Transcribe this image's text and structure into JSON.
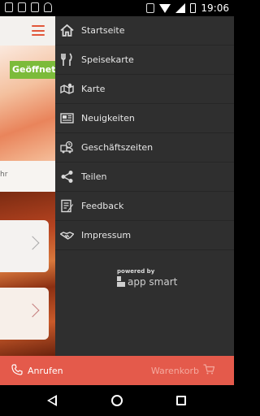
{
  "status_bar": {
    "time": "19:06"
  },
  "app": {
    "open_badge": "Geöffnet",
    "hours_fragment": "hr"
  },
  "drawer": {
    "items": [
      {
        "label": "Startseite",
        "icon": "home-icon"
      },
      {
        "label": "Speisekarte",
        "icon": "cutlery-icon"
      },
      {
        "label": "Karte",
        "icon": "map-icon"
      },
      {
        "label": "Neuigkeiten",
        "icon": "newspaper-icon"
      },
      {
        "label": "Geschäftszeiten",
        "icon": "clock-truck-icon"
      },
      {
        "label": "Teilen",
        "icon": "share-icon"
      },
      {
        "label": "Feedback",
        "icon": "feedback-icon"
      },
      {
        "label": "Impressum",
        "icon": "handshake-icon"
      }
    ],
    "powered_by": "powered by",
    "brand": "app smart"
  },
  "actionbar": {
    "call_label": "Anrufen",
    "cart_label": "Warenkorb"
  },
  "colors": {
    "accent": "#e45a4b",
    "drawer_bg": "#2f2f2f",
    "open_badge": "#7cbb3a"
  }
}
